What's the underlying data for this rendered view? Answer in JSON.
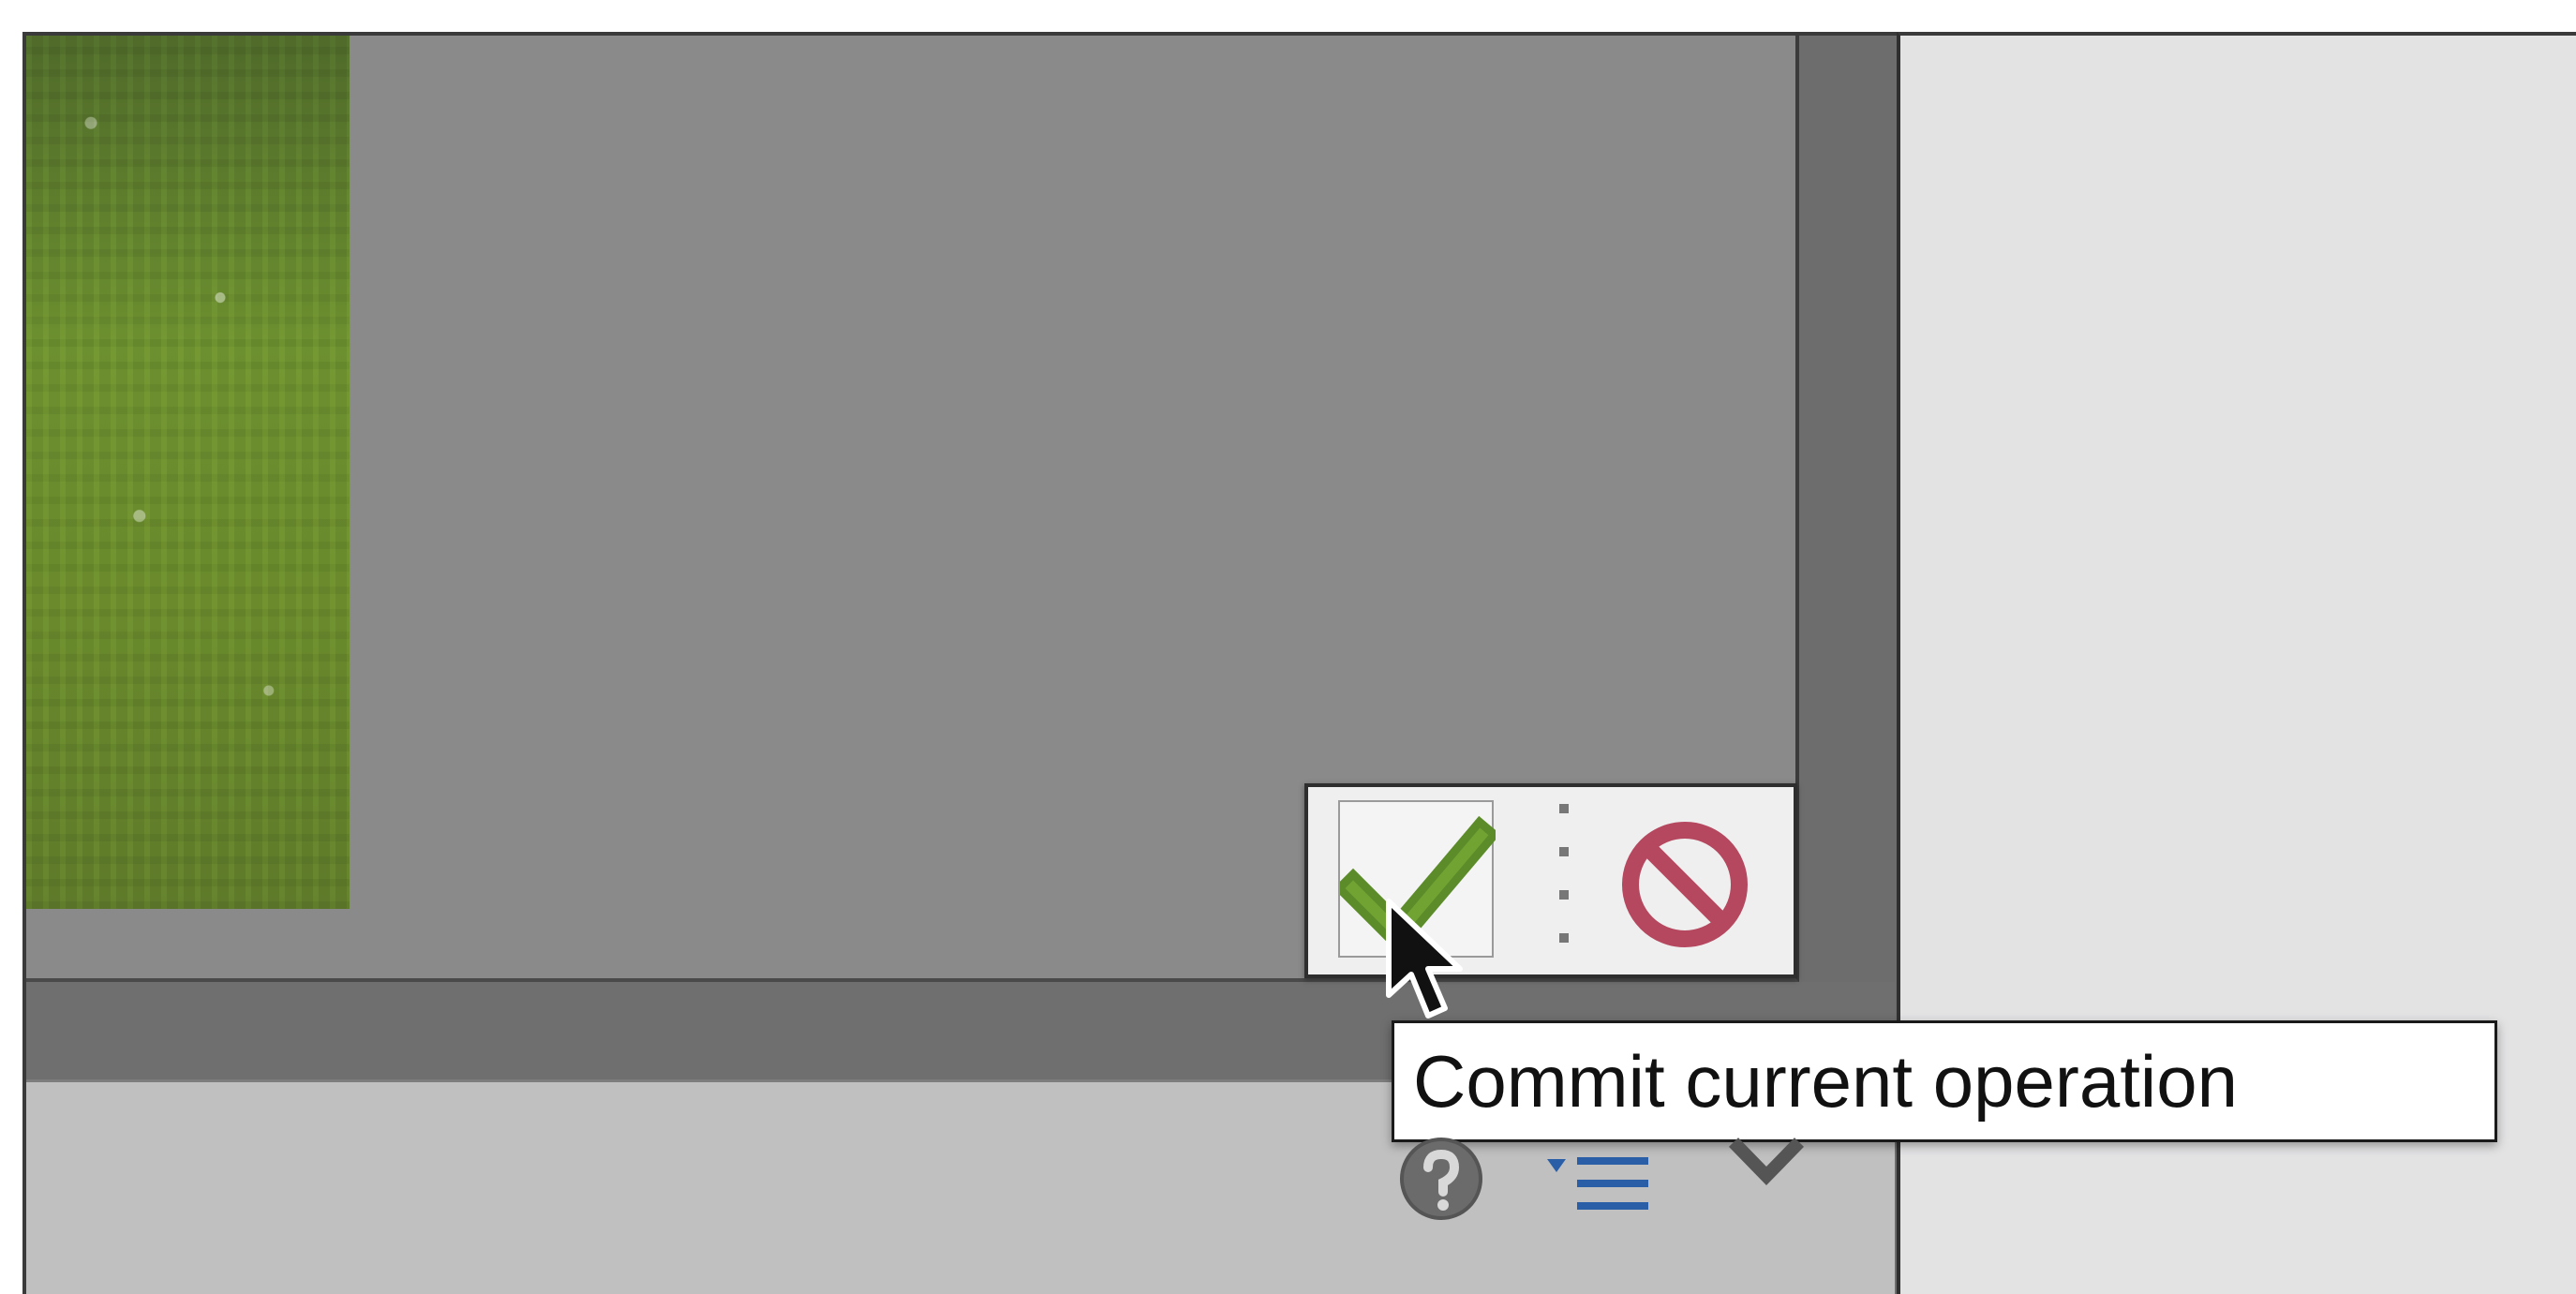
{
  "tooltip": {
    "text": "Commit current operation"
  },
  "commit_widget": {
    "commit_icon": "checkmark-icon",
    "cancel_icon": "no-entry-icon"
  },
  "bottom_panel": {
    "icons": [
      "help-icon",
      "list-menu-icon",
      "chevron-down-icon"
    ]
  },
  "colors": {
    "commit_green": "#5c8c2a",
    "cancel_red": "#b5475f",
    "workspace_gray": "#8a8a8a",
    "panel_gray": "#c0c0c0",
    "right_panel": "#e3e3e4",
    "menu_blue": "#2a5fa8"
  }
}
